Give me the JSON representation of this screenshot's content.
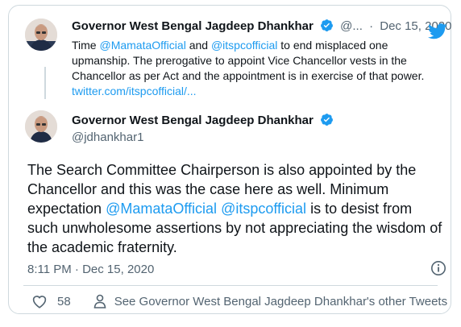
{
  "quoted": {
    "author": "Governor West Bengal Jagdeep Dhankhar",
    "handle": "@...",
    "sep": "·",
    "date": "Dec 15, 2020",
    "text_parts": [
      {
        "t": "Time ",
        "link": false
      },
      {
        "t": "@MamataOfficial",
        "link": true
      },
      {
        "t": " and ",
        "link": false
      },
      {
        "t": "@itspcofficial",
        "link": true
      },
      {
        "t": " to end misplaced one upmanship. The prerogative to appoint Vice Chancellor vests in the Chancellor as per Act and the appointment is in exercise of that power. ",
        "link": false
      },
      {
        "t": "twitter.com/itspcofficial/...",
        "link": true
      }
    ]
  },
  "main": {
    "author": "Governor West Bengal Jagdeep Dhankhar",
    "handle": "@jdhankhar1",
    "text_parts": [
      {
        "t": "The Search Committee Chairperson is also appointed by the Chancellor and this was the case here as well. Minimum expectation ",
        "link": false
      },
      {
        "t": "@MamataOfficial",
        "link": true
      },
      {
        "t": " ",
        "link": false
      },
      {
        "t": "@itspcofficial",
        "link": true
      },
      {
        "t": " is to desist from such unwholesome assertions by not appreciating the wisdom of the academic fraternity.",
        "link": false
      }
    ],
    "timestamp": "8:11 PM · Dec 15, 2020"
  },
  "actions": {
    "likes": "58",
    "see_more": "See Governor West Bengal Jagdeep Dhankhar's other Tweets"
  },
  "icons": {
    "verified": "verified-badge-icon",
    "logo": "twitter-bird-icon",
    "info": "info-icon",
    "heart": "heart-icon",
    "person": "person-icon"
  },
  "colors": {
    "link": "#1d9bf0",
    "text": "#0f1419",
    "muted": "#536471",
    "border": "#cfd9de"
  }
}
